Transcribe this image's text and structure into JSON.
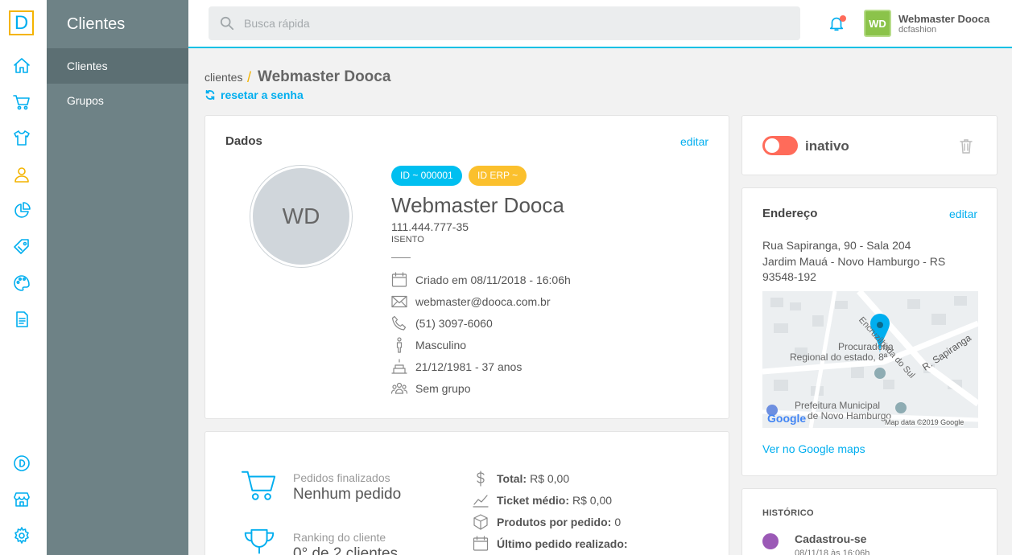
{
  "brand": {
    "logo_letter": "D",
    "accent": "#00aeef",
    "highlight": "#f4b400"
  },
  "rail": {
    "items": [
      {
        "icon": "home-icon"
      },
      {
        "icon": "cart-icon"
      },
      {
        "icon": "shirt-icon"
      },
      {
        "icon": "user-icon",
        "active": true
      },
      {
        "icon": "pie-chart-icon"
      },
      {
        "icon": "tag-icon"
      },
      {
        "icon": "palette-icon"
      },
      {
        "icon": "document-icon"
      }
    ],
    "bottom": [
      {
        "icon": "dooca-icon"
      },
      {
        "icon": "store-icon"
      },
      {
        "icon": "gear-icon"
      }
    ]
  },
  "subnav": {
    "title": "Clientes",
    "items": [
      {
        "label": "Clientes",
        "active": true
      },
      {
        "label": "Grupos",
        "active": false
      }
    ]
  },
  "topbar": {
    "search_placeholder": "Busca rápida",
    "user": {
      "initials": "WD",
      "name": "Webmaster Dooca",
      "store": "dcfashion"
    }
  },
  "breadcrumb": {
    "parent": "clientes",
    "separator": "/",
    "current": "Webmaster Dooca",
    "reset_label": "resetar a senha"
  },
  "dados": {
    "title": "Dados",
    "edit_label": "editar",
    "avatar_initials": "WD",
    "badge_id": "ID ~ 000001",
    "badge_erp": "ID ERP ~",
    "name": "Webmaster Dooca",
    "document": "111.444.777-35",
    "ie": "ISENTO",
    "created": "Criado em 08/11/2018 - 16:06h",
    "email": "webmaster@dooca.com.br",
    "phone": "(51) 3097-6060",
    "gender": "Masculino",
    "birthday": "21/12/1981 - 37 anos",
    "group": "Sem grupo"
  },
  "stats": {
    "orders_label": "Pedidos finalizados",
    "orders_value": "Nenhum pedido",
    "ranking_label": "Ranking do cliente",
    "ranking_value": "0° de 2 clientes",
    "total_label": "Total:",
    "total_value": "R$ 0,00",
    "ticket_label": "Ticket médio:",
    "ticket_value": "R$ 0,00",
    "products_label": "Produtos por pedido:",
    "products_value": "0",
    "last_order_label": "Último pedido realizado:"
  },
  "status": {
    "label": "inativo",
    "toggle_color": "#ff6b5a"
  },
  "endereco": {
    "title": "Endereço",
    "edit_label": "editar",
    "line1": "Rua Sapiranga, 90 - Sala 204",
    "line2": "Jardim Mauá - Novo Hamburgo - RS",
    "line3": "93548-192",
    "map": {
      "street1": "Encruzilhada do Sul",
      "street2": "R. Sapiranga",
      "poi1_line1": "Procuradoria",
      "poi1_line2": "Regional do estado, 8ª",
      "poi2_line1": "Prefeitura Municipal",
      "poi2_line2": "de Novo Hamburgo",
      "google": "Google",
      "credits": "Map data ©2019 Google"
    },
    "map_link": "Ver no Google maps"
  },
  "historico": {
    "title": "HISTÓRICO",
    "event": "Cadastrou-se",
    "date": "08/11/18 às 16:06h"
  }
}
